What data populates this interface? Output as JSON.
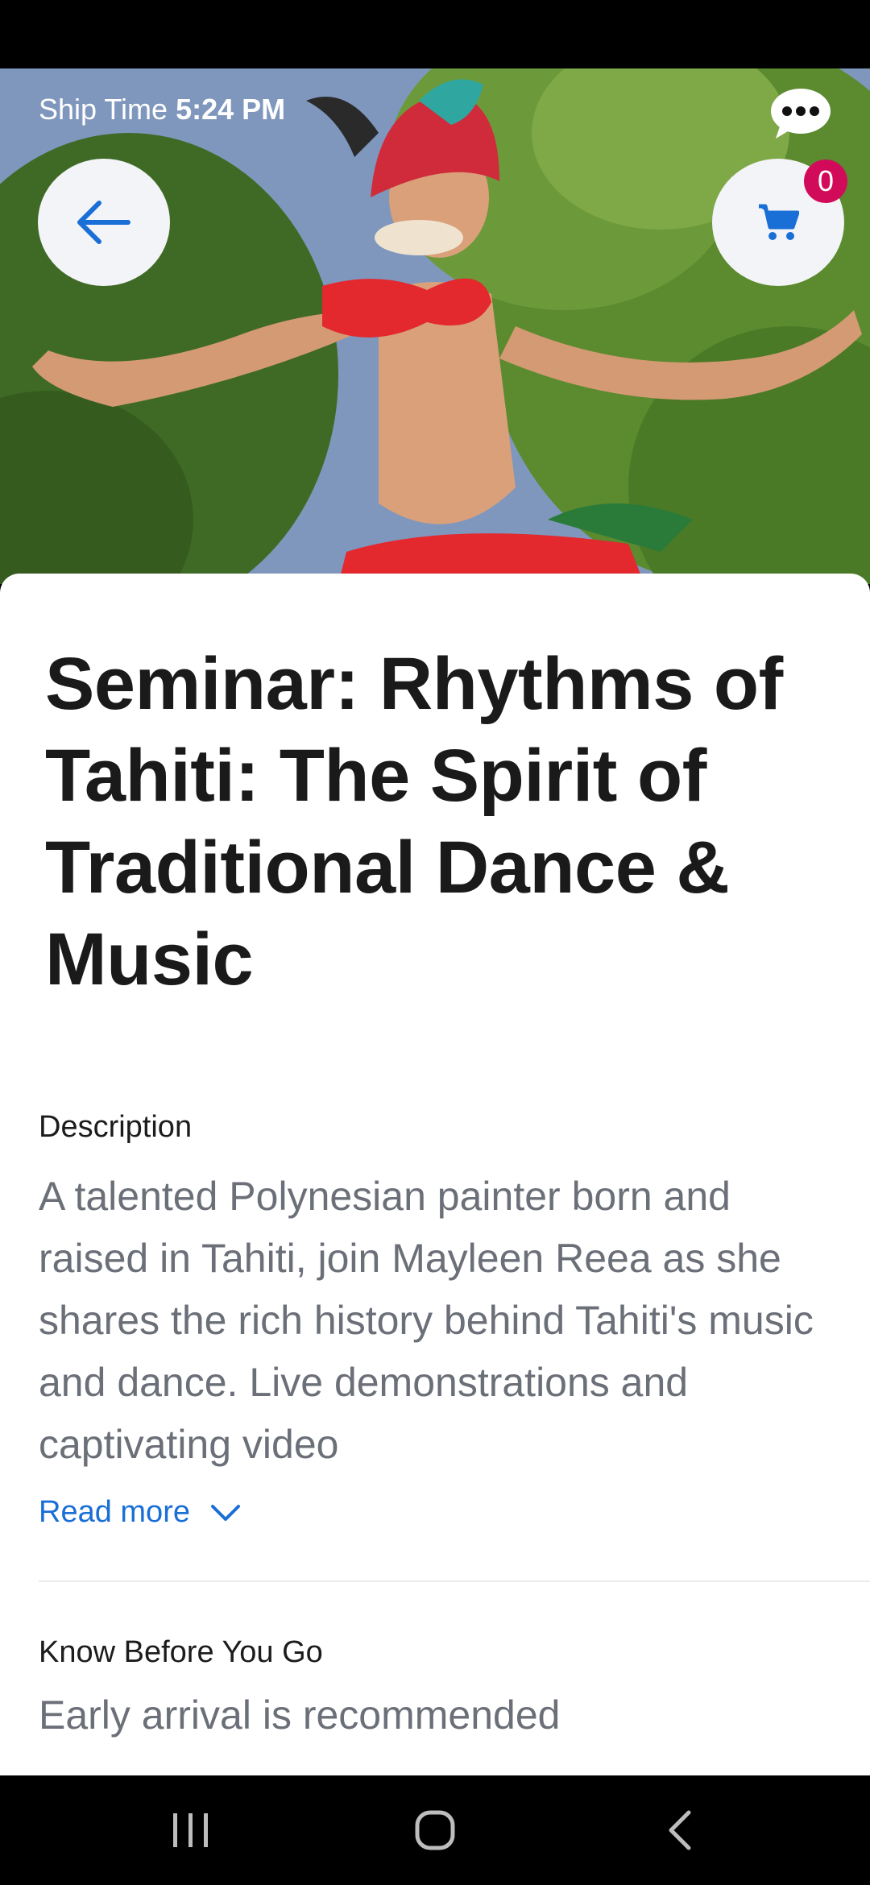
{
  "header": {
    "ship_time_label": "Ship Time",
    "ship_time_value": "5:24 PM",
    "cart_count": "0"
  },
  "event": {
    "title": "Seminar: Rhythms of Tahiti: The Spirit of Traditional Dance & Music"
  },
  "description": {
    "label": "Description",
    "text": "A talented Polynesian painter born and raised in Tahiti, join Mayleen Reea as she shares the rich history behind Tahiti's music and dance. Live demonstrations and captivating video",
    "read_more_label": "Read more"
  },
  "know_before_you_go": {
    "label": "Know Before You Go",
    "text": "Early arrival is recommended"
  },
  "icons": {
    "back": "arrow-left-icon",
    "cart": "cart-icon",
    "chat": "chat-bubble-icon",
    "read_more": "chevron-down-icon"
  },
  "colors": {
    "accent": "#1a6fd6",
    "badge": "#d10b59",
    "title": "#1a1a1a",
    "body": "#6b6f78"
  }
}
